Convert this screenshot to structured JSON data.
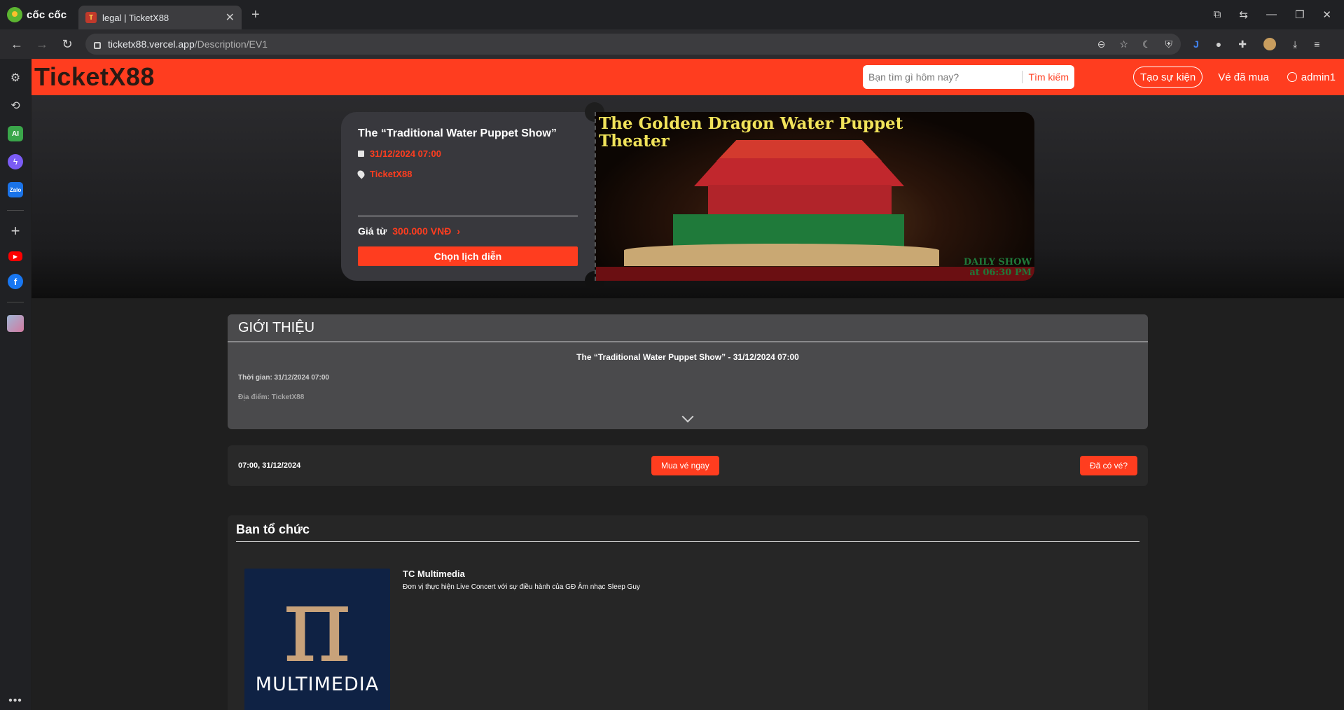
{
  "browser": {
    "brand": "cốc cốc",
    "tab_title": "legal | TicketX88",
    "url_host": "ticketx88.vercel.app",
    "url_path": "/Description/EV1"
  },
  "header": {
    "logo": "TicketX88",
    "search_placeholder": "Bạn tìm gì hôm nay?",
    "search_button": "Tìm kiếm",
    "create_event": "Tạo sự kiện",
    "purchased_tickets": "Vé đã mua",
    "username": "admin1"
  },
  "hero": {
    "title": "The “Traditional Water Puppet Show”",
    "datetime": "31/12/2024 07:00",
    "location": "TicketX88",
    "price_label": "Giá từ",
    "price_value": "300.000 VNĐ",
    "choose_button": "Chọn lịch diễn",
    "image_title_1": "The Golden Dragon Water Puppet",
    "image_title_2": "Theater",
    "image_caption_1": "DAILY SHOW",
    "image_caption_2": "at 06:30 PM"
  },
  "intro": {
    "heading": "GIỚI THIỆU",
    "subtitle": "The “Traditional Water Puppet Show” - 31/12/2024 07:00",
    "time_line": "Thời gian: 31/12/2024 07:00",
    "location_line": "Địa điểm: TicketX88"
  },
  "schedule": {
    "time": "07:00, 31/12/2024",
    "buy_button": "Mua vé ngay",
    "have_ticket_button": "Đã có vé?"
  },
  "organizer": {
    "heading": "Ban tổ chức",
    "logo_symbol": "π",
    "logo_text": "MULTIMEDIA",
    "name": "TC Multimedia",
    "description": "Đơn vị thực hiện Live Concert với sự điều hành của GĐ Âm nhạc Sleep Guy"
  },
  "colors": {
    "accent": "#ff3d1f",
    "background": "#1f1f1f"
  }
}
